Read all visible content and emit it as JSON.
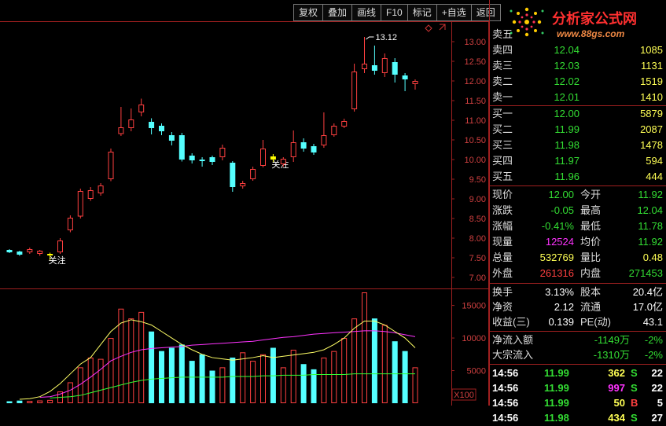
{
  "toolbar": {
    "buttons": [
      "复权",
      "叠加",
      "画线",
      "F10",
      "标记",
      "+自选",
      "返回"
    ]
  },
  "logo": {
    "title": "分析家公式网",
    "url": "www.88gs.com"
  },
  "colors": {
    "up": "#ff4040",
    "down": "#55ffff",
    "mark": "#ffff00",
    "ma5": "#ffff66",
    "ma10": "#ff33ff",
    "ma20": "#33ff33"
  },
  "chart": {
    "price_ticks": [
      "13.00",
      "12.50",
      "12.00",
      "11.50",
      "11.00",
      "10.50",
      "10.00",
      "9.50",
      "9.00",
      "8.50",
      "8.00",
      "7.50",
      "7.00"
    ],
    "volume_ticks": [
      "15000",
      "10000",
      "5000"
    ],
    "volume_unit": "X100",
    "high_label": "13.12",
    "marker_label": "关注"
  },
  "chart_data": {
    "type": "candlestick",
    "ylim": [
      7.0,
      13.0
    ],
    "candles": [
      {
        "o": 7.7,
        "c": 7.64,
        "h": 7.72,
        "l": 7.62
      },
      {
        "o": 7.66,
        "c": 7.58,
        "h": 7.68,
        "l": 7.55
      },
      {
        "o": 7.64,
        "c": 7.72,
        "h": 7.76,
        "l": 7.6
      },
      {
        "o": 7.6,
        "c": 7.68,
        "h": 7.7,
        "l": 7.55
      },
      {
        "o": 7.56,
        "c": 7.6,
        "h": 7.63,
        "l": 7.42
      },
      {
        "o": 7.64,
        "c": 7.94,
        "h": 8.0,
        "l": 7.6
      },
      {
        "o": 8.2,
        "c": 8.52,
        "h": 8.58,
        "l": 8.15
      },
      {
        "o": 8.55,
        "c": 9.2,
        "h": 9.26,
        "l": 8.5
      },
      {
        "o": 9.0,
        "c": 9.22,
        "h": 9.3,
        "l": 8.95
      },
      {
        "o": 9.14,
        "c": 9.34,
        "h": 9.4,
        "l": 9.08
      },
      {
        "o": 9.5,
        "c": 10.2,
        "h": 10.28,
        "l": 9.45
      },
      {
        "o": 10.65,
        "c": 10.82,
        "h": 11.34,
        "l": 10.6
      },
      {
        "o": 10.8,
        "c": 11.02,
        "h": 11.3,
        "l": 10.72
      },
      {
        "o": 11.2,
        "c": 11.4,
        "h": 11.55,
        "l": 11.1
      },
      {
        "o": 10.96,
        "c": 10.8,
        "h": 11.05,
        "l": 10.64
      },
      {
        "o": 10.86,
        "c": 10.72,
        "h": 10.92,
        "l": 10.62
      },
      {
        "o": 10.62,
        "c": 10.48,
        "h": 10.7,
        "l": 10.36
      },
      {
        "o": 10.62,
        "c": 10.0,
        "h": 10.68,
        "l": 9.95
      },
      {
        "o": 10.1,
        "c": 9.98,
        "h": 10.16,
        "l": 9.9
      },
      {
        "o": 10.0,
        "c": 9.96,
        "h": 10.06,
        "l": 9.82
      },
      {
        "o": 10.06,
        "c": 9.94,
        "h": 10.1,
        "l": 9.86
      },
      {
        "o": 10.06,
        "c": 10.3,
        "h": 10.38,
        "l": 9.98
      },
      {
        "o": 9.92,
        "c": 9.3,
        "h": 9.96,
        "l": 9.18
      },
      {
        "o": 9.32,
        "c": 9.4,
        "h": 9.46,
        "l": 9.26
      },
      {
        "o": 9.5,
        "c": 9.76,
        "h": 9.82,
        "l": 9.46
      },
      {
        "o": 9.84,
        "c": 10.28,
        "h": 10.5,
        "l": 9.8
      },
      {
        "o": 10.08,
        "c": 10.0,
        "h": 10.14,
        "l": 9.92
      },
      {
        "o": 9.88,
        "c": 10.02,
        "h": 10.06,
        "l": 9.82
      },
      {
        "o": 10.06,
        "c": 10.44,
        "h": 10.74,
        "l": 9.94
      },
      {
        "o": 10.44,
        "c": 10.28,
        "h": 10.54,
        "l": 10.2
      },
      {
        "o": 10.34,
        "c": 10.18,
        "h": 10.4,
        "l": 10.12
      },
      {
        "o": 10.36,
        "c": 10.62,
        "h": 11.2,
        "l": 10.3
      },
      {
        "o": 10.62,
        "c": 10.86,
        "h": 10.92,
        "l": 10.58
      },
      {
        "o": 10.84,
        "c": 10.98,
        "h": 11.04,
        "l": 10.8
      },
      {
        "o": 11.28,
        "c": 12.24,
        "h": 12.44,
        "l": 11.22
      },
      {
        "o": 12.3,
        "c": 12.44,
        "h": 13.12,
        "l": 12.2
      },
      {
        "o": 12.4,
        "c": 12.26,
        "h": 12.9,
        "l": 12.16
      },
      {
        "o": 12.2,
        "c": 12.58,
        "h": 12.7,
        "l": 12.1
      },
      {
        "o": 12.48,
        "c": 12.16,
        "h": 12.58,
        "l": 11.96
      },
      {
        "o": 12.14,
        "c": 12.04,
        "h": 12.2,
        "l": 11.74
      },
      {
        "o": 11.92,
        "c": 12.0,
        "h": 12.04,
        "l": 11.78
      }
    ],
    "marked": [
      4,
      26
    ],
    "volume_ylim": [
      0,
      17000
    ],
    "volumes": [
      300,
      400,
      350,
      420,
      500,
      1800,
      3200,
      5500,
      7000,
      6800,
      10000,
      14500,
      13000,
      14000,
      11000,
      8000,
      8500,
      9000,
      6500,
      7500,
      5000,
      5500,
      7000,
      7800,
      6500,
      7500,
      8500,
      5500,
      8200,
      6000,
      5200,
      7000,
      8000,
      10000,
      13000,
      17000,
      13000,
      12000,
      9500,
      8000,
      5500
    ],
    "ma5": [
      600,
      700,
      1000,
      1800,
      3000,
      4500,
      6000,
      7000,
      9000,
      11000,
      12300,
      12800,
      12500,
      12000,
      11000,
      10000,
      9000,
      8200,
      7500,
      7000,
      6800,
      6600,
      6800,
      7000,
      7300,
      7000,
      7200,
      7400,
      7600,
      7800,
      8200,
      9000,
      10000,
      11500,
      12600,
      12600,
      12000,
      11000,
      10000,
      8500
    ],
    "ma10": [
      900,
      1000,
      1400,
      2000,
      2900,
      4000,
      5200,
      6500,
      7200,
      7800,
      8200,
      8400,
      8500,
      8600,
      8700,
      8900,
      9000,
      9100,
      9200,
      9300,
      9400,
      9500,
      9700,
      9900,
      10100,
      10200,
      10400,
      10600,
      10700,
      10800,
      10900,
      11000,
      11100,
      11100,
      11000,
      10800,
      10500,
      10200
    ],
    "ma20": [
      800,
      900,
      1000,
      1200,
      1600,
      2000,
      2400,
      2800,
      3200,
      3500,
      3700,
      3800,
      3900,
      4000,
      4000,
      4000,
      4000,
      4000,
      4100,
      4100,
      4100,
      4200,
      4200,
      4300,
      4300,
      4300,
      4400,
      4400,
      4400,
      4400,
      4500,
      4500,
      4500,
      4500,
      4500,
      4500,
      4500
    ]
  },
  "quotes": {
    "sell": [
      {
        "label": "卖五",
        "price": "",
        "vol": ""
      },
      {
        "label": "卖四",
        "price": "12.04",
        "vol": "1085"
      },
      {
        "label": "卖三",
        "price": "12.03",
        "vol": "1131"
      },
      {
        "label": "卖二",
        "price": "12.02",
        "vol": "1519"
      },
      {
        "label": "卖一",
        "price": "12.01",
        "vol": "1410"
      }
    ],
    "buy": [
      {
        "label": "买一",
        "price": "12.00",
        "vol": "5879"
      },
      {
        "label": "买二",
        "price": "11.99",
        "vol": "2087"
      },
      {
        "label": "买三",
        "price": "11.98",
        "vol": "1478"
      },
      {
        "label": "买四",
        "price": "11.97",
        "vol": "594"
      },
      {
        "label": "买五",
        "price": "11.96",
        "vol": "444"
      }
    ]
  },
  "stats": [
    {
      "l1": "现价",
      "v1": "12.00",
      "c1": "g",
      "l2": "今开",
      "v2": "11.92",
      "c2": "g"
    },
    {
      "l1": "涨跌",
      "v1": "-0.05",
      "c1": "g",
      "l2": "最高",
      "v2": "12.04",
      "c2": "g"
    },
    {
      "l1": "涨幅",
      "v1": "-0.41%",
      "c1": "g",
      "l2": "最低",
      "v2": "11.78",
      "c2": "g"
    },
    {
      "l1": "现量",
      "v1": "12524",
      "c1": "m",
      "l2": "均价",
      "v2": "11.92",
      "c2": "g"
    },
    {
      "l1": "总量",
      "v1": "532769",
      "c1": "y",
      "l2": "量比",
      "v2": "0.48",
      "c2": "y"
    },
    {
      "l1": "外盘",
      "v1": "261316",
      "c1": "r",
      "l2": "内盘",
      "v2": "271453",
      "c2": "g"
    }
  ],
  "stats2": [
    {
      "l1": "换手",
      "v1": "3.13%",
      "c1": "w",
      "l2": "股本",
      "v2": "20.4亿",
      "c2": "w"
    },
    {
      "l1": "净资",
      "v1": "2.12",
      "c1": "w",
      "l2": "流通",
      "v2": "17.0亿",
      "c2": "w"
    },
    {
      "l1": "收益(三)",
      "v1": "0.139",
      "c1": "w",
      "l2": "PE(动)",
      "v2": "43.1",
      "c2": "w"
    }
  ],
  "flows": [
    {
      "label": "净流入额",
      "value": "-1149万",
      "pct": "-2%"
    },
    {
      "label": "大宗流入",
      "value": "-1310万",
      "pct": "-2%"
    }
  ],
  "ticks": [
    {
      "time": "14:56",
      "price": "11.99",
      "vol": "362",
      "side": "S",
      "n": "22"
    },
    {
      "time": "14:56",
      "price": "11.99",
      "vol": "997",
      "side": "S",
      "n": "22"
    },
    {
      "time": "14:56",
      "price": "11.99",
      "vol": "50",
      "side": "B",
      "n": "5"
    },
    {
      "time": "14:56",
      "price": "11.98",
      "vol": "434",
      "side": "S",
      "n": "27"
    }
  ]
}
